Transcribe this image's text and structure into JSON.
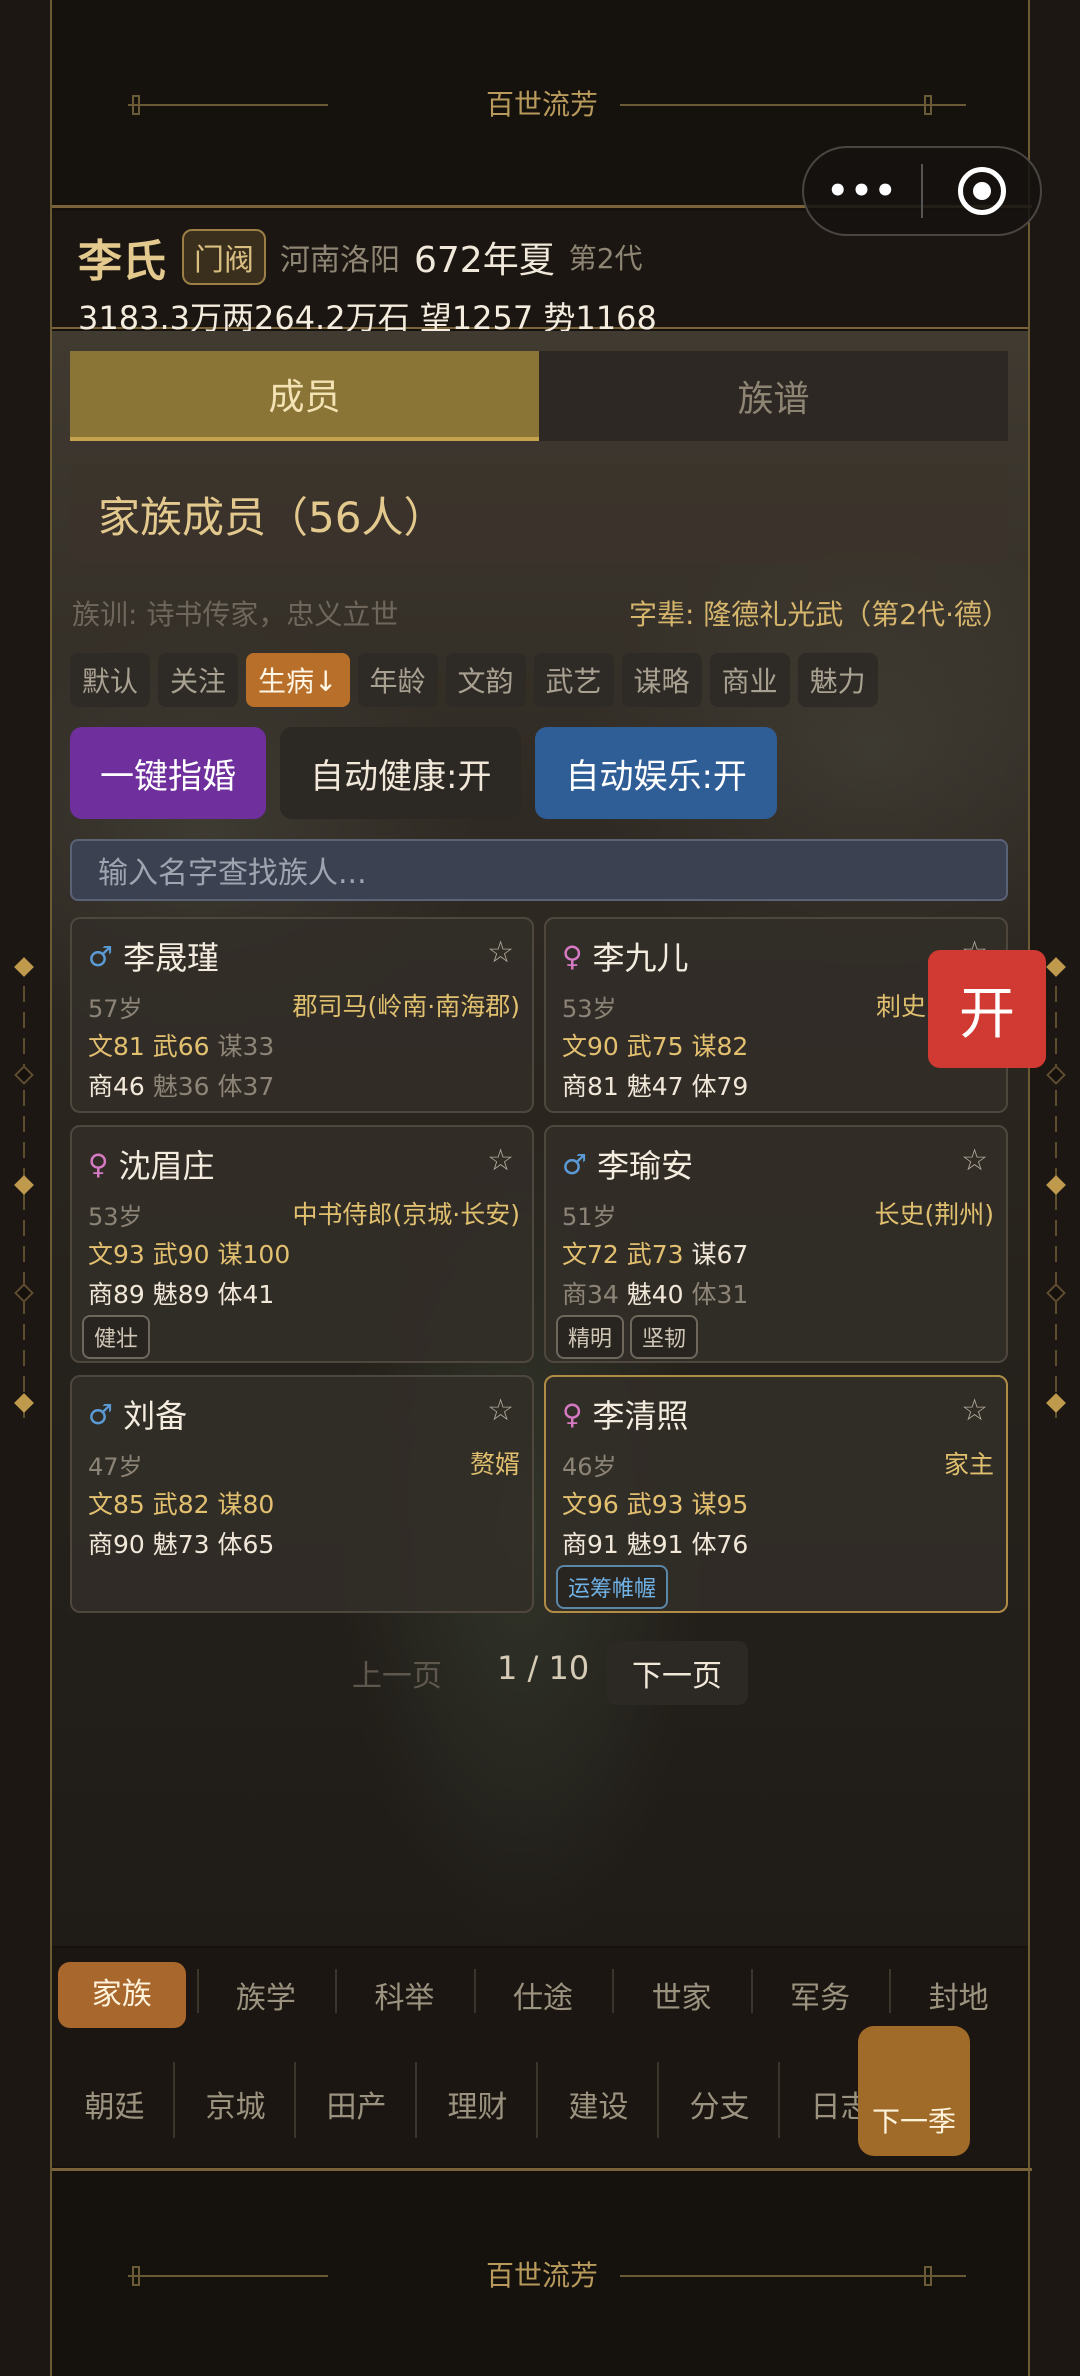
{
  "banner": {
    "title": "百世流芳"
  },
  "header": {
    "family_name": "李氏",
    "rank": "门阀",
    "place": "河南洛阳",
    "year": "672年夏",
    "generation": "第2代",
    "resources": "3183.3万两264.2万石  望1257 势1168"
  },
  "tabs": [
    {
      "label": "成员",
      "active": true
    },
    {
      "label": "族谱",
      "active": false
    }
  ],
  "section_title": "家族成员（56人）",
  "motto": "族训: 诗书传家，忠义立世",
  "generation_words": "字辈: 隆德礼光武（第2代·德）",
  "filters": [
    "默认",
    "关注",
    "生病↓",
    "年龄",
    "文韵",
    "武艺",
    "谋略",
    "商业",
    "魅力"
  ],
  "actions": {
    "arrange_marriage": "一键指婚",
    "auto_health": "自动健康:开",
    "auto_fun": "自动娱乐:开"
  },
  "search": {
    "placeholder": "输入名字查找族人..."
  },
  "members": [
    {
      "sex": "♂",
      "name": "李晟瑾",
      "age": "57岁",
      "title": "郡司马(岭南·南海郡)",
      "wen": "文81",
      "wu": "武66",
      "mou": "谋33",
      "shang": "商46",
      "mei": "魅36",
      "ti": "体37",
      "tags": []
    },
    {
      "sex": "♀",
      "name": "李九儿",
      "age": "53岁",
      "title": "刺史",
      "wen": "文90",
      "wu": "武75",
      "mou": "谋82",
      "shang": "商81",
      "mei": "魅47",
      "ti": "体79",
      "tags": []
    },
    {
      "sex": "♀",
      "name": "沈眉庄",
      "age": "53岁",
      "title": "中书侍郎(京城·长安)",
      "wen": "文93",
      "wu": "武90",
      "mou": "谋100",
      "shang": "商89",
      "mei": "魅89",
      "ti": "体41",
      "tags": [
        "健壮"
      ]
    },
    {
      "sex": "♂",
      "name": "李瑜安",
      "age": "51岁",
      "title": "长史(荆州)",
      "wen": "文72",
      "wu": "武73",
      "mou": "谋67",
      "shang": "商34",
      "mei": "魅40",
      "ti": "体31",
      "tags": [
        "精明",
        "坚韧"
      ]
    },
    {
      "sex": "♂",
      "name": "刘备",
      "age": "47岁",
      "title": "赘婿",
      "wen": "文85",
      "wu": "武82",
      "mou": "谋80",
      "shang": "商90",
      "mei": "魅73",
      "ti": "体65",
      "tags": []
    },
    {
      "sex": "♀",
      "name": "李清照",
      "age": "46岁",
      "title": "家主",
      "wen": "文96",
      "wu": "武93",
      "mou": "谋95",
      "shang": "商91",
      "mei": "魅91",
      "ti": "体76",
      "tags": [
        "运筹帷幄"
      ]
    }
  ],
  "star_icon": "☆",
  "pager": {
    "prev": "上一页",
    "current": "1 / 10",
    "next": "下一页"
  },
  "float_button": "开",
  "nav_row1": [
    "家族",
    "族学",
    "科举",
    "仕途",
    "世家",
    "军务",
    "封地"
  ],
  "nav_row2": [
    "朝廷",
    "京城",
    "田产",
    "理财",
    "建设",
    "分支",
    "日志"
  ],
  "next_season": "下一季",
  "capsule": {
    "more": "•••"
  },
  "colors": {
    "accent_gold": "#c4a24e",
    "active_orange": "#a8672c",
    "purple": "#6f2f9c",
    "blue": "#2f5d96",
    "red": "#d03a32"
  }
}
